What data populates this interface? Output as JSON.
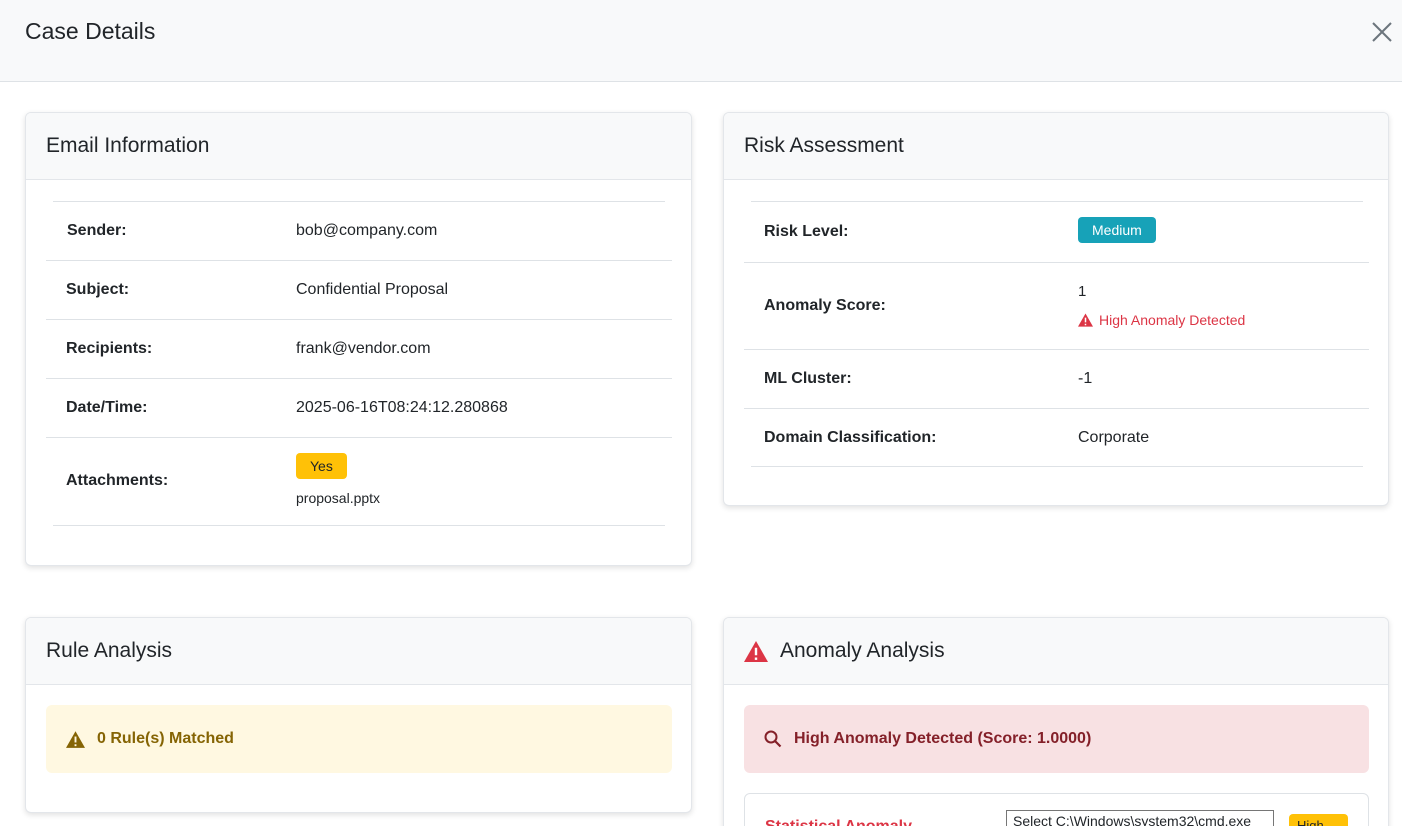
{
  "modal": {
    "title": "Case Details",
    "close_label": "×"
  },
  "email_info": {
    "title": "Email Information",
    "rows": [
      {
        "label": "Sender:",
        "value": "bob@company.com"
      },
      {
        "label": "Subject:",
        "value": "Confidential Proposal"
      },
      {
        "label": "Recipients:",
        "value": "frank@vendor.com"
      },
      {
        "label": "Date/Time:",
        "value": "2025-06-16T08:24:12.280868"
      }
    ],
    "attachments": {
      "label": "Attachments:",
      "badge": "Yes",
      "file": "proposal.pptx"
    }
  },
  "risk": {
    "title": "Risk Assessment",
    "risk_level": {
      "label": "Risk Level:",
      "badge": "Medium"
    },
    "anomaly_score": {
      "label": "Anomaly Score:",
      "value": "1",
      "flag": "High Anomaly Detected"
    },
    "ml_cluster": {
      "label": "ML Cluster:",
      "value": "-1"
    },
    "domain": {
      "label": "Domain Classification:",
      "value": "Corporate"
    }
  },
  "rule_analysis": {
    "title": "Rule Analysis",
    "alert": "0 Rule(s) Matched"
  },
  "anomaly_analysis": {
    "title": "Anomaly Analysis",
    "alert": "High Anomaly Detected (Score: 1.0000)",
    "stat_label": "Statistical Anomaly",
    "badge_partial": "High"
  },
  "overlay": {
    "select_text": "Select C:\\Windows\\system32\\cmd.exe"
  },
  "colors": {
    "accent_teal": "#17a2b8",
    "warning": "#ffc107",
    "danger": "#dc3545"
  }
}
